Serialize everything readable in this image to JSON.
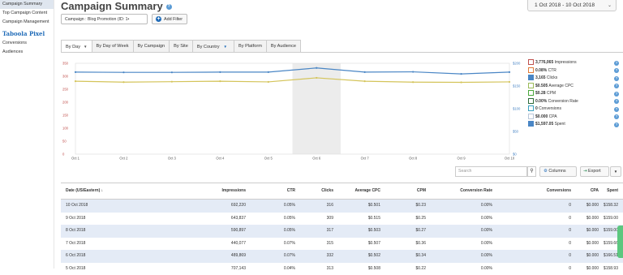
{
  "sidebar": {
    "items_top": [
      "Campaign Summary",
      "Top Campaign Content",
      "Campaign Management"
    ],
    "active_index": 0,
    "section": "Taboola Pixel",
    "items_pixel": [
      "Conversions",
      "Audiences"
    ]
  },
  "header": {
    "title": "Campaign Summary",
    "help": "?",
    "date_range": "1 Oct 2018 - 10 Oct 2018"
  },
  "filters": {
    "campaign": "Campaign : Blog Promotion (ID: 1•",
    "add_filter": "Add Filter"
  },
  "tabs": [
    "By Day",
    "By Day of Week",
    "By Campaign",
    "By Site",
    "By Country",
    "By Platform",
    "By Audience"
  ],
  "chart_data": {
    "type": "line",
    "categories": [
      "Oct 1",
      "Oct 2",
      "Oct 3",
      "Oct 4",
      "Oct 5",
      "Oct 6",
      "Oct 7",
      "Oct 8",
      "Oct 9",
      "Oct 10"
    ],
    "left_ticks": [
      "0",
      "50",
      "100",
      "150",
      "200",
      "250",
      "300",
      "350"
    ],
    "right_ticks": [
      "$0",
      "$50",
      "$100",
      "$150",
      "$200"
    ],
    "ylim_left": [
      0,
      350
    ],
    "ylim_right": [
      0,
      200
    ],
    "highlight_categories": [
      "Oct 6"
    ],
    "series": [
      {
        "name": "Clicks",
        "axis": "left",
        "color": "#4a86c5",
        "values": [
          316,
          315,
          315,
          316,
          316,
          332,
          316,
          317,
          309,
          316
        ]
      },
      {
        "name": "Spent",
        "axis": "right",
        "color": "#d4c45a",
        "values": [
          160.5,
          158.5,
          159.5,
          160.5,
          159,
          168,
          160.5,
          158.5,
          158,
          159
        ]
      }
    ]
  },
  "legend": [
    {
      "value": "3,776,065",
      "label": "Impressions",
      "color": "#c0504d",
      "checked": false
    },
    {
      "value": "0.08%",
      "label": "CTR",
      "color": "#e07b39",
      "checked": false
    },
    {
      "value": "3,165",
      "label": "Clicks",
      "color": "#4a86c5",
      "checked": true
    },
    {
      "value": "$0.505",
      "label": "Average CPC",
      "color": "#9bbb59",
      "checked": false
    },
    {
      "value": "$0.28",
      "label": "CPM",
      "color": "#4aa83c",
      "checked": false
    },
    {
      "value": "0.00%",
      "label": "Conversion Rate",
      "color": "#2e6b3a",
      "checked": false
    },
    {
      "value": "0",
      "label": "Conversions",
      "color": "#3aa0c0",
      "checked": false
    },
    {
      "value": "$0.000",
      "label": "CPA",
      "color": "#b8c7d9",
      "checked": false
    },
    {
      "value": "$1,597.05",
      "label": "Spent",
      "color": "#4a86c5",
      "checked": true
    }
  ],
  "toolbar": {
    "search_placeholder": "Search",
    "columns": "Columns",
    "export": "Export"
  },
  "table": {
    "columns": [
      "Date (US/Eastern) ↓",
      "Impressions",
      "CTR",
      "Clicks",
      "Average CPC",
      "CPM",
      "Conversion Rate",
      "Conversions",
      "CPA",
      "Spent"
    ],
    "rows": [
      [
        "10 Oct 2018",
        "692,220",
        "0.05%",
        "316",
        "$0.501",
        "$0.23",
        "0.00%",
        "0",
        "$0.000",
        "$158.32"
      ],
      [
        "9 Oct 2018",
        "643,837",
        "0.05%",
        "309",
        "$0.515",
        "$0.25",
        "0.00%",
        "0",
        "$0.000",
        "$159.00"
      ],
      [
        "8 Oct 2018",
        "590,897",
        "0.05%",
        "317",
        "$0.503",
        "$0.27",
        "0.00%",
        "0",
        "$0.000",
        "$159.00"
      ],
      [
        "7 Oct 2018",
        "440,077",
        "0.07%",
        "315",
        "$0.507",
        "$0.36",
        "0.00%",
        "0",
        "$0.000",
        "$159.66"
      ],
      [
        "6 Oct 2018",
        "489,869",
        "0.07%",
        "332",
        "$0.502",
        "$0.34",
        "0.00%",
        "0",
        "$0.000",
        "$166.51"
      ],
      [
        "5 Oct 2018",
        "707,143",
        "0.04%",
        "313",
        "$0.508",
        "$0.22",
        "0.00%",
        "0",
        "$0.000",
        "$158.93"
      ]
    ]
  }
}
